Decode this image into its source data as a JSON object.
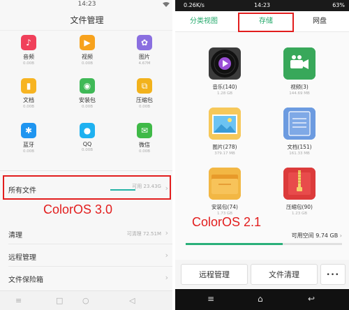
{
  "left": {
    "status_time": "14:23",
    "title": "文件管理",
    "categories": [
      {
        "name": "音频",
        "size": "0.00B",
        "icon": "music-icon",
        "color": "#f0405a",
        "glyph": "♪"
      },
      {
        "name": "视频",
        "size": "0.00B",
        "icon": "video-icon",
        "color": "#f7a21d",
        "glyph": "▶"
      },
      {
        "name": "图片",
        "size": "4.67M",
        "icon": "picture-icon",
        "color": "#8a6fe0",
        "glyph": "✿"
      },
      {
        "name": "文档",
        "size": "0.00B",
        "icon": "document-icon",
        "color": "#f7b422",
        "glyph": "▮"
      },
      {
        "name": "安装包",
        "size": "0.00B",
        "icon": "android-icon",
        "color": "#3fb957",
        "glyph": "◉"
      },
      {
        "name": "压缩包",
        "size": "0.00B",
        "icon": "zip-icon",
        "color": "#f2b21c",
        "glyph": "⧉"
      },
      {
        "name": "蓝牙",
        "size": "0.00B",
        "icon": "bluetooth-icon",
        "color": "#1f95f0",
        "glyph": "✱"
      },
      {
        "name": "QQ",
        "size": "0.00B",
        "icon": "qq-icon",
        "color": "#1fb1f0",
        "glyph": "●"
      },
      {
        "name": "微信",
        "size": "0.00B",
        "icon": "wechat-icon",
        "color": "#3fb947",
        "glyph": "✉"
      }
    ],
    "all_files": {
      "label": "所有文件",
      "available": "可用 23.43G",
      "usage_fraction": 0.35
    },
    "clean": {
      "label": "清理",
      "sub": "可清理 72.51M"
    },
    "remote": {
      "label": "远程管理"
    },
    "safe": {
      "label": "文件保险箱"
    },
    "annotation": "ColorOS 3.0",
    "accent": "#e21d1d"
  },
  "right": {
    "status_speed": "0.26K/s",
    "status_time": "14:23",
    "status_battery": "63%",
    "tabs": [
      "分类视图",
      "存储",
      "网盘"
    ],
    "files": [
      {
        "name": "音乐(140)",
        "size": "1.28 GB",
        "icon": "music-disc-icon"
      },
      {
        "name": "视频(3)",
        "size": "144.69 MB",
        "icon": "video-camera-icon"
      },
      {
        "name": "图片(278)",
        "size": "379.17 MB",
        "icon": "picture-folder-icon"
      },
      {
        "name": "文档(151)",
        "size": "161.33 MB",
        "icon": "document-notebook-icon"
      },
      {
        "name": "安装包(74)",
        "size": "1.73 GB",
        "icon": "package-folder-icon"
      },
      {
        "name": "压缩包(90)",
        "size": "1.23 GB",
        "icon": "zip-folder-icon"
      }
    ],
    "available": "可用空间 9.74 GB",
    "usage_fraction": 0.62,
    "buttons": [
      "远程管理",
      "文件清理",
      "•••"
    ],
    "annotation": "ColorOS 2.1",
    "tab_accent": "#24a96b"
  }
}
